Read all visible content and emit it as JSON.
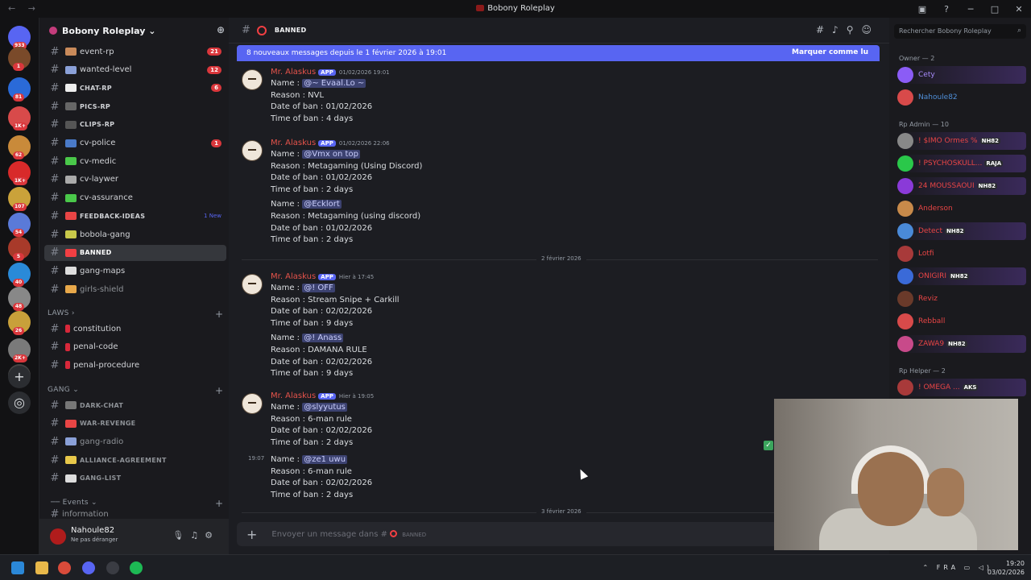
{
  "window": {
    "title": "Bobony Roleplay"
  },
  "server": {
    "name": "Bobony Roleplay"
  },
  "guild_badges": [
    "933",
    "1",
    "81",
    "1K+",
    "62",
    "1K+",
    "107",
    "54",
    "5",
    "40",
    "48",
    "26",
    "2K+"
  ],
  "channels": [
    {
      "name": "event-rp",
      "badge": "21"
    },
    {
      "name": "wanted-level",
      "badge": "12"
    },
    {
      "name": "CHAT-RP",
      "badge": "6"
    },
    {
      "name": "PICS-RP",
      "badge": ""
    },
    {
      "name": "CLIPS-RP",
      "badge": ""
    },
    {
      "name": "cv-police",
      "badge": "1"
    },
    {
      "name": "cv-medic",
      "badge": ""
    },
    {
      "name": "cv-laywer",
      "badge": ""
    },
    {
      "name": "cv-assurance",
      "badge": ""
    },
    {
      "name": "FEEDBACK-IDEAS",
      "badge": "1 New"
    },
    {
      "name": "bobola-gang",
      "badge": ""
    },
    {
      "name": "BANNED",
      "badge": ""
    },
    {
      "name": "gang-maps",
      "badge": ""
    },
    {
      "name": "girls-shield",
      "badge": ""
    }
  ],
  "categories": {
    "laws": "LAWS",
    "gang": "GANG",
    "events": "Events"
  },
  "laws_channels": [
    "constitution",
    "penal-code",
    "penal-procedure"
  ],
  "gang_channels": [
    "DARK-CHAT",
    "WAR-REVENGE",
    "gang-radio",
    "ALLIANCE-AGREEMENT",
    "GANG-LIST"
  ],
  "events_partial": "information",
  "user": {
    "name": "Nahoule82",
    "status": "Ne pas déranger"
  },
  "header": {
    "channel": "BANNED"
  },
  "newbar": {
    "text": "8 nouveaux messages depuis le 1 février 2026 à 19:01",
    "action": "Marquer comme lu"
  },
  "messages": [
    {
      "author": "Mr. Alaskus",
      "app": "APP",
      "time": "01/02/2026 19:01",
      "lines": [
        "Name : |@~ Evaal.Lo ~",
        "Reason : NVL",
        "Date of ban : 01/02/2026",
        "Time of ban : 4 days"
      ]
    },
    {
      "author": "Mr. Alaskus",
      "app": "APP",
      "time": "01/02/2026 22:06",
      "lines": [
        "Name : |@Vmx on top",
        "Reason : Metagaming (Using Discord)",
        "Date of ban : 01/02/2026",
        "Time of ban : 2 days",
        "Name : |@Ecklort",
        "Reason : Metagaming (using discord)",
        "Date of ban : 01/02/2026",
        "Time of ban : 2 days"
      ]
    },
    {
      "author": "Mr. Alaskus",
      "app": "APP",
      "time": "Hier à 17:45",
      "lines": [
        "Name : |@!  OFF",
        "Reason : Stream Snipe + Carkill",
        "Date of ban : 02/02/2026",
        "Time of ban : 9 days",
        "Name : |@!                 Anass",
        "Reason : DAMANA RULE",
        "Date of ban : 02/02/2026",
        "Time of ban : 9 days"
      ]
    },
    {
      "author": "Mr. Alaskus",
      "app": "APP",
      "time": "Hier à 19:05",
      "lines": [
        "Name : |@slyyutus",
        "Reason : 6-man rule",
        "Date of ban : 02/02/2026",
        "Time of ban : 2 days"
      ]
    },
    {
      "side_time": "19:07",
      "lines": [
        "Name : |@ze1 uwu",
        "Reason : 6-man rule",
        "Date of ban : 02/02/2026",
        "Time of ban : 2 days"
      ]
    }
  ],
  "dividers": [
    "2 février 2026",
    "3 février 2026"
  ],
  "composer": {
    "placeholder": "Envoyer un message dans #",
    "channel": "BANNED"
  },
  "members_search": "Rechercher Bobony Roleplay",
  "roles": [
    {
      "title": "Owner — 2",
      "members": [
        {
          "name": "Cety",
          "color": "#a78bfa",
          "tag": ""
        },
        {
          "name": "Nahoule82",
          "color": "#4f8fd8",
          "tag": ""
        }
      ]
    },
    {
      "title": "Rp Admin — 10",
      "members": [
        {
          "name": "! $IMO Ormes %",
          "color": "#e84545",
          "tag": "NH82"
        },
        {
          "name": "! PSYCHOSKULL...",
          "color": "#e84545",
          "tag": "RAJA"
        },
        {
          "name": "24 MOUSSAOUI",
          "color": "#e84545",
          "tag": "NH82"
        },
        {
          "name": "Anderson",
          "color": "#e84545",
          "tag": ""
        },
        {
          "name": "Detect",
          "color": "#e84545",
          "tag": "NH82"
        },
        {
          "name": "Lotfi",
          "color": "#e84545",
          "tag": ""
        },
        {
          "name": "ONIGIRI",
          "color": "#e84545",
          "tag": "NH82"
        },
        {
          "name": "Reviz",
          "color": "#e84545",
          "tag": ""
        },
        {
          "name": "Rebball",
          "color": "#e84545",
          "tag": ""
        },
        {
          "name": "ZAWA9",
          "color": "#e84545",
          "tag": "NH82"
        }
      ]
    },
    {
      "title": "Rp Helper — 2",
      "members": [
        {
          "name": "! OMEGA ...",
          "color": "#e84545",
          "tag": "AKS"
        }
      ]
    }
  ],
  "taskbar": {
    "lang": "FRA",
    "time": "19:20",
    "date": "03/02/2026"
  }
}
